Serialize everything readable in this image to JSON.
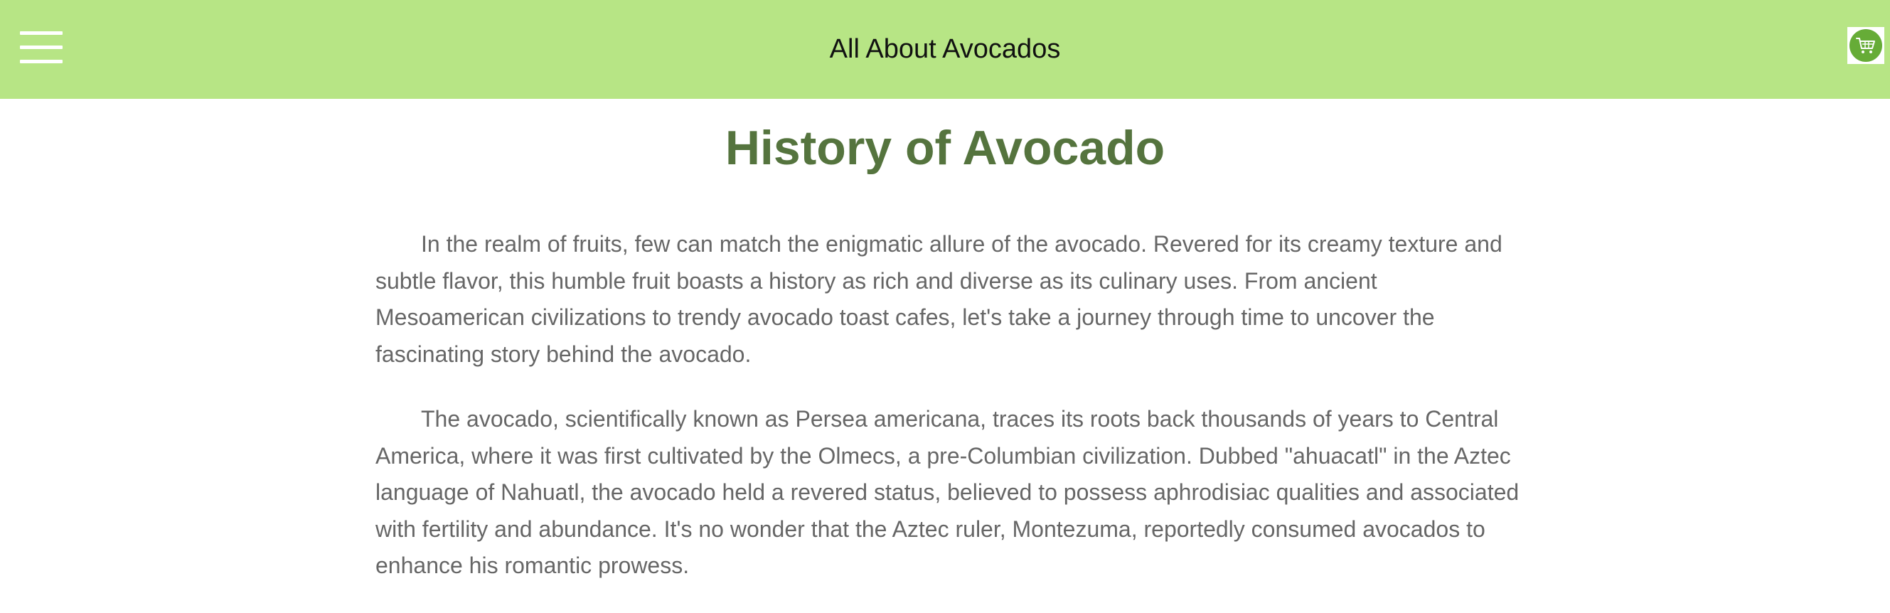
{
  "header": {
    "title": "All About Avocados",
    "menu_icon": "hamburger-menu-icon",
    "cart_icon": "shopping-cart-icon",
    "background_color": "#b7e585",
    "cart_color": "#66ac37"
  },
  "main": {
    "heading": "History of Avocado",
    "heading_color": "#55743e",
    "paragraphs": [
      "In the realm of fruits, few can match the enigmatic allure of the avocado. Revered for its creamy texture and subtle flavor, this humble fruit boasts a history as rich and diverse as its culinary uses. From ancient Mesoamerican civilizations to trendy avocado toast cafes, let's take a journey through time to uncover the fascinating story behind the avocado.",
      "The avocado, scientifically known as Persea americana, traces its roots back thousands of years to Central America, where it was first cultivated by the Olmecs, a pre-Columbian civilization. Dubbed \"ahuacatl\" in the Aztec language of Nahuatl, the avocado held a revered status, believed to possess aphrodisiac qualities and associated with fertility and abundance. It's no wonder that the Aztec ruler, Montezuma, reportedly consumed avocados to enhance his romantic prowess."
    ]
  }
}
